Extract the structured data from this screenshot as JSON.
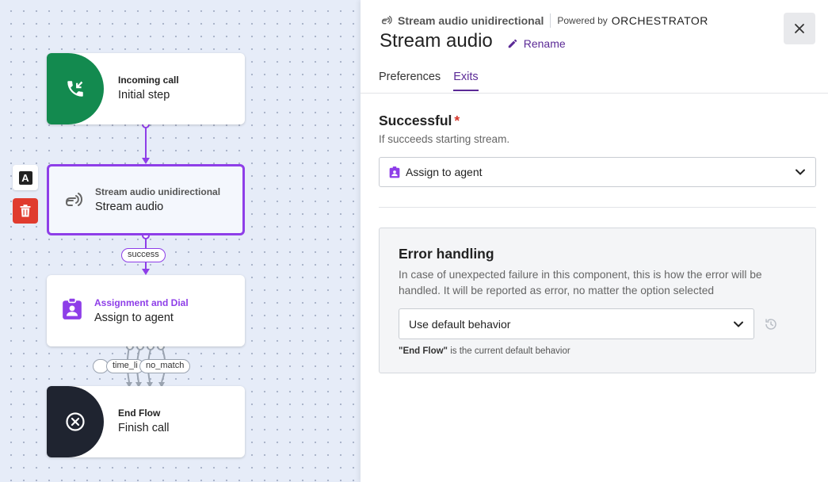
{
  "canvas": {
    "nodes": [
      {
        "id": "incoming",
        "category": "Incoming call",
        "label": "Initial step",
        "icon": "incoming-call-icon",
        "color": "#138a4f"
      },
      {
        "id": "stream",
        "category": "Stream audio unidirectional",
        "label": "Stream audio",
        "icon": "stream-audio-icon",
        "selected": true
      },
      {
        "id": "assign",
        "category": "Assignment and Dial",
        "label": "Assign to agent",
        "icon": "assign-agent-icon",
        "color": "#8e3ee8"
      },
      {
        "id": "end",
        "category": "End Flow",
        "label": "Finish call",
        "icon": "close-circle-icon",
        "color": "#1f2430"
      }
    ],
    "edge_labels": {
      "success": "success",
      "time_limit": "time_li",
      "no_match": "no_match"
    },
    "tools": {
      "text_button": "A"
    }
  },
  "panel": {
    "component_type": "Stream audio unidirectional",
    "powered_by": "Powered by",
    "vendor": "ORCHESTRATOR",
    "title": "Stream audio",
    "rename_label": "Rename",
    "tabs": [
      {
        "label": "Preferences",
        "active": false
      },
      {
        "label": "Exits",
        "active": true
      }
    ],
    "successful": {
      "title": "Successful",
      "required_mark": "*",
      "description": "If succeeds starting stream.",
      "selected": "Assign to agent"
    },
    "error_handling": {
      "title": "Error handling",
      "description": "In case of unexpected failure in this component, this is how the error will be handled. It will be reported as error, no matter the option selected",
      "selected": "Use default behavior",
      "note_bold": "\"End Flow\"",
      "note_rest": " is the current default behavior"
    }
  },
  "colors": {
    "accent": "#5b2a96",
    "selected_border": "#8e3ee8",
    "delete": "#e03b2e",
    "required": "#d6372c"
  }
}
